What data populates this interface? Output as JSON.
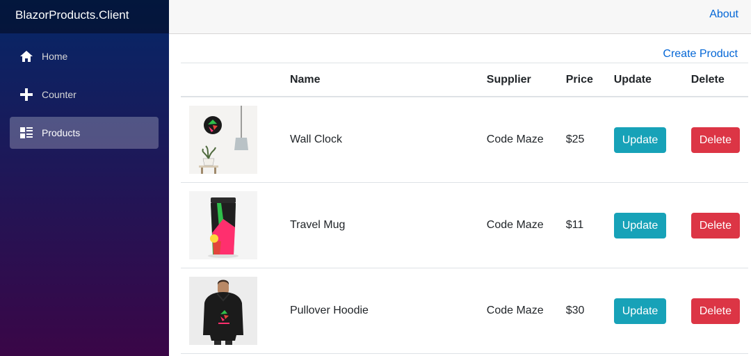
{
  "app": {
    "brand": "BlazorProducts.Client"
  },
  "sidebar": {
    "items": [
      {
        "label": "Home",
        "icon": "home-icon",
        "active": false
      },
      {
        "label": "Counter",
        "icon": "plus-icon",
        "active": false
      },
      {
        "label": "Products",
        "icon": "list-icon",
        "active": true
      }
    ]
  },
  "topbar": {
    "about_label": "About"
  },
  "main": {
    "create_label": "Create Product",
    "table": {
      "headers": [
        "",
        "Name",
        "Supplier",
        "Price",
        "Update",
        "Delete"
      ],
      "rows": [
        {
          "name": "Wall Clock",
          "supplier": "Code Maze",
          "price": "$25",
          "update_label": "Update",
          "delete_label": "Delete"
        },
        {
          "name": "Travel Mug",
          "supplier": "Code Maze",
          "price": "$11",
          "update_label": "Update",
          "delete_label": "Delete"
        },
        {
          "name": "Pullover Hoodie",
          "supplier": "Code Maze",
          "price": "$30",
          "update_label": "Update",
          "delete_label": "Delete"
        }
      ]
    }
  },
  "colors": {
    "link": "#0366d6",
    "update": "#17a2b8",
    "delete": "#dc3545"
  }
}
